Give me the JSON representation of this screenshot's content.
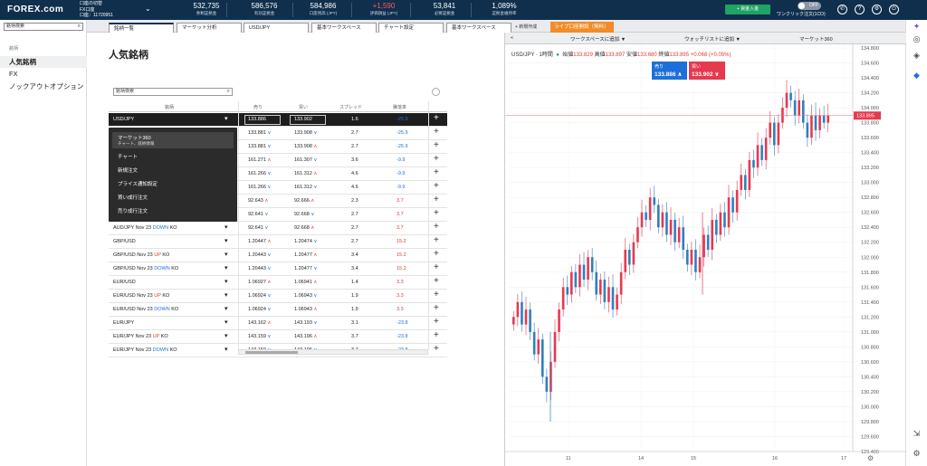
{
  "topbar": {
    "logo": "FOREX.com",
    "account_line1": "口座の切替",
    "account_line2": "FX口座",
    "account_line3": "口座：11720951",
    "stats": [
      {
        "value": "532,735",
        "label": "余剰証拠金",
        "color": "#ffffff"
      },
      {
        "value": "586,576",
        "label": "有効証拠金",
        "color": "#ffffff"
      },
      {
        "value": "584,986",
        "label": "口座残高 (JPY)",
        "color": "#ffffff"
      },
      {
        "value": "+1,590",
        "label": "評価損益 (JPY)",
        "color": "#ff5a5a"
      },
      {
        "value": "53,841",
        "label": "必要証拠金",
        "color": "#ffffff"
      },
      {
        "value": "1,089%",
        "label": "証拠金維持率",
        "color": "#ffffff"
      }
    ],
    "deposit_button": "+ 資金入金",
    "toggle_label": "OFF",
    "oneclick_label": "ワンクリック注文(1CO)"
  },
  "sidebar": {
    "search_placeholder": "銘柄検索",
    "heading": "銘柄",
    "items": [
      "人気銘柄",
      "FX",
      "ノックアウトオプション"
    ]
  },
  "tabs": [
    "銘柄一覧",
    "マーケット分析",
    "USD/JPY",
    "基本ワークスペース",
    "チャート設定",
    "基本ワークスペース"
  ],
  "tab_new": "+ 新規作成",
  "tab_live": "ライブ口座開設（無料）",
  "main_title": "人気銘柄",
  "table": {
    "search_placeholder": "銘柄検索",
    "headers": [
      "銘柄",
      "売り",
      "買い",
      "スプレッド",
      "騰落率"
    ],
    "rows": [
      {
        "name": "USD/JPY",
        "sell": "133.886",
        "buy": "133.902",
        "spread": "1.6",
        "chg": "-25.9",
        "chg_dir": "neg"
      },
      {
        "name": "",
        "sell": "133.881",
        "buy": "133.908",
        "spread": "2.7",
        "chg": "-25.9",
        "chg_dir": "neg"
      },
      {
        "name": "",
        "sell": "133.881",
        "buy": "133.908",
        "spread": "2.7",
        "chg": "-25.9",
        "chg_dir": "neg"
      },
      {
        "name": "",
        "sell": "161.271",
        "buy": "161.307",
        "spread": "3.6",
        "chg": "-9.9",
        "chg_dir": "neg"
      },
      {
        "name": "",
        "sell": "161.266",
        "buy": "161.312",
        "spread": "4.6",
        "chg": "-9.9",
        "chg_dir": "neg"
      },
      {
        "name": "",
        "sell": "161.266",
        "buy": "161.312",
        "spread": "4.6",
        "chg": "-9.9",
        "chg_dir": "neg"
      },
      {
        "name": "",
        "sell": "92.643",
        "buy": "92.666",
        "spread": "2.3",
        "chg": "3.7",
        "chg_dir": "pos"
      },
      {
        "name": "",
        "sell": "92.641",
        "buy": "92.668",
        "spread": "2.7",
        "chg": "3.7",
        "chg_dir": "pos"
      },
      {
        "name": "AUD/JPY Nov 23 ",
        "ko": "DOWN",
        "ko_suffix": " KO",
        "sell": "92.641",
        "buy": "92.668",
        "spread": "2.7",
        "chg": "3.7",
        "chg_dir": "pos"
      },
      {
        "name": "GBP/USD",
        "sell": "1.20447",
        "buy": "1.20474",
        "spread": "2.7",
        "chg": "15.2",
        "chg_dir": "pos"
      },
      {
        "name": "GBP/USD Nov 23 ",
        "ko": "UP",
        "ko_suffix": " KO",
        "sell": "1.20443",
        "buy": "1.20477",
        "spread": "3.4",
        "chg": "15.2",
        "chg_dir": "pos"
      },
      {
        "name": "GBP/USD Nov 23 ",
        "ko": "DOWN",
        "ko_suffix": " KO",
        "sell": "1.20443",
        "buy": "1.20477",
        "spread": "3.4",
        "chg": "15.2",
        "chg_dir": "pos"
      },
      {
        "name": "EUR/USD",
        "sell": "1.06927",
        "buy": "1.06941",
        "spread": "1.4",
        "chg": "3.3",
        "chg_dir": "pos"
      },
      {
        "name": "EUR/USD Nov 23 ",
        "ko": "UP",
        "ko_suffix": " KO",
        "sell": "1.06924",
        "buy": "1.06943",
        "spread": "1.9",
        "chg": "3.3",
        "chg_dir": "pos"
      },
      {
        "name": "EUR/USD Nov 23 ",
        "ko": "DOWN",
        "ko_suffix": " KO",
        "sell": "1.06924",
        "buy": "1.06943",
        "spread": "1.9",
        "chg": "3.3",
        "chg_dir": "pos"
      },
      {
        "name": "EUR/JPY",
        "sell": "143.162",
        "buy": "143.193",
        "spread": "3.1",
        "chg": "-23.8",
        "chg_dir": "neg"
      },
      {
        "name": "EUR/JPY Nov 23 ",
        "ko": "UP",
        "ko_suffix": " KO",
        "sell": "143.159",
        "buy": "143.196",
        "spread": "3.7",
        "chg": "-23.8",
        "chg_dir": "neg"
      },
      {
        "name": "EUR/JPY Nov 23 ",
        "ko": "DOWN",
        "ko_suffix": " KO",
        "sell": "143.159",
        "buy": "143.196",
        "spread": "3.7",
        "chg": "-23.8",
        "chg_dir": "neg"
      }
    ]
  },
  "dropdown": {
    "items": [
      {
        "label": "マーケット360",
        "sub": "チャート、銘柄情報"
      },
      {
        "label": "チャート"
      },
      {
        "label": "新規注文"
      },
      {
        "label": "プライス通知設定"
      },
      {
        "label": "買い成行注文"
      },
      {
        "label": "売り成行注文"
      }
    ]
  },
  "chart_panel": {
    "toolbar_workspace": "ワークスペースに追加 ▼",
    "toolbar_watchlist": "ウォッチリストに追加 ▼",
    "toolbar_m360": "マーケット360",
    "symbol": "USD/JPY · 1時間",
    "ohlc": {
      "open_label": "始値",
      "open": "133.829",
      "high_label": "高値",
      "high": "133.897",
      "low_label": "安値",
      "low": "133.680",
      "close_label": "終値",
      "close": "133.895",
      "change": "+0.068 (+0.05%)"
    },
    "sell_label": "売り",
    "sell_price": "133.886 ∧",
    "buy_label": "買い",
    "buy_price": "133.902 ∨",
    "up_color": "#e53950",
    "down_color": "#2f7fc1"
  },
  "chart_data": {
    "type": "candlestick",
    "title": "USD/JPY · 1時間",
    "y_ticks": [
      "134.800",
      "134.600",
      "134.400",
      "134.200",
      "134.000",
      "133.800",
      "133.600",
      "133.400",
      "133.200",
      "133.000",
      "132.800",
      "132.600",
      "132.400",
      "132.200",
      "132.000",
      "131.800",
      "131.600",
      "131.400",
      "131.200",
      "131.000",
      "130.800",
      "130.600",
      "130.400",
      "130.200",
      "130.000",
      "129.800",
      "129.600",
      "129.400"
    ],
    "x_ticks": [
      "11",
      "14",
      "15",
      "16",
      "17"
    ],
    "ylim": [
      129.4,
      134.8
    ],
    "last_price": "133.895",
    "close_series": [
      131.2,
      131.4,
      131.1,
      131.3,
      131.0,
      130.7,
      130.9,
      130.4,
      130.2,
      130.6,
      131.0,
      131.3,
      131.6,
      131.5,
      131.8,
      131.6,
      131.9,
      131.7,
      132.0,
      131.8,
      131.5,
      131.7,
      131.4,
      131.6,
      131.3,
      131.5,
      131.8,
      132.1,
      131.9,
      132.2,
      132.4,
      132.6,
      132.5,
      132.8,
      132.7,
      132.4,
      132.6,
      132.3,
      132.5,
      132.2,
      132.4,
      132.1,
      131.9,
      132.1,
      131.8,
      132.0,
      132.3,
      132.1,
      132.5,
      132.3,
      132.6,
      132.4,
      132.8,
      132.6,
      132.9,
      133.1,
      132.9,
      133.3,
      133.2,
      133.5,
      133.3,
      133.6,
      133.8,
      133.5,
      133.8,
      134.0,
      134.2,
      134.1,
      133.9,
      134.1,
      133.8,
      133.6,
      133.9,
      133.7,
      133.9,
      133.8,
      133.9
    ]
  }
}
